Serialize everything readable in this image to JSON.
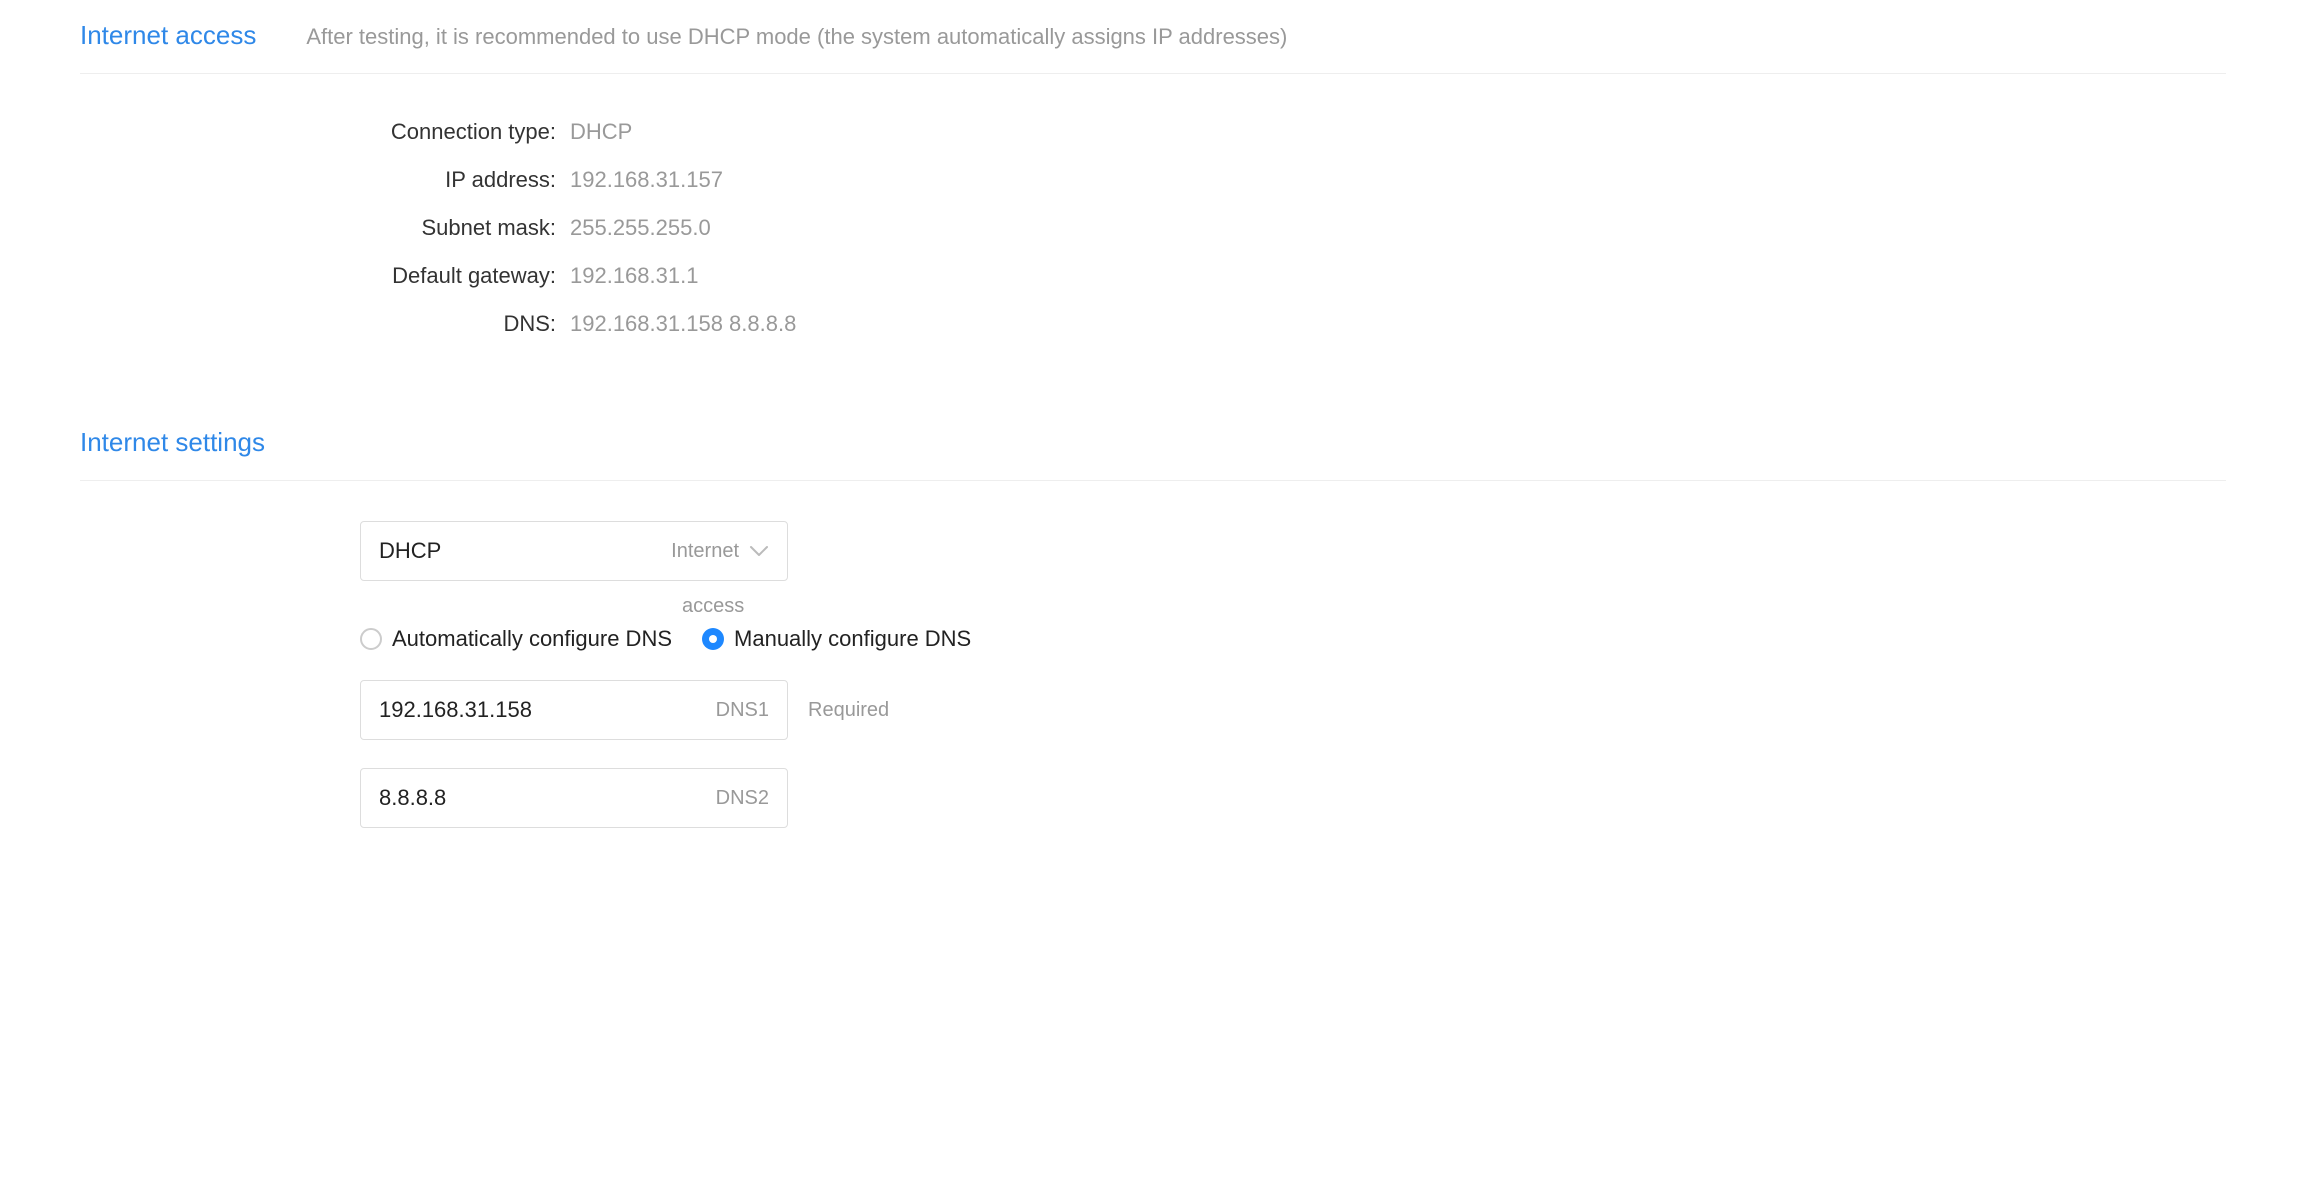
{
  "internet_access": {
    "title": "Internet access",
    "hint": "After testing, it is recommended to use DHCP mode (the system automatically assigns IP addresses)",
    "fields": {
      "connection_type": {
        "label": "Connection type:",
        "value": "DHCP"
      },
      "ip_address": {
        "label": "IP address:",
        "value": "192.168.31.157"
      },
      "subnet_mask": {
        "label": "Subnet mask:",
        "value": "255.255.255.0"
      },
      "default_gateway": {
        "label": "Default gateway:",
        "value": "192.168.31.1"
      },
      "dns": {
        "label": "DNS:",
        "value": "192.168.31.158 8.8.8.8"
      }
    }
  },
  "internet_settings": {
    "title": "Internet settings",
    "mode_select": {
      "value": "DHCP",
      "inner_label": "Internet",
      "sub_label": "access"
    },
    "dns_mode": {
      "auto_label": "Automatically configure DNS",
      "manual_label": "Manually configure DNS",
      "selected": "manual"
    },
    "dns1": {
      "value": "192.168.31.158",
      "inner_label": "DNS1",
      "hint": "Required"
    },
    "dns2": {
      "value": "8.8.8.8",
      "inner_label": "DNS2"
    }
  }
}
